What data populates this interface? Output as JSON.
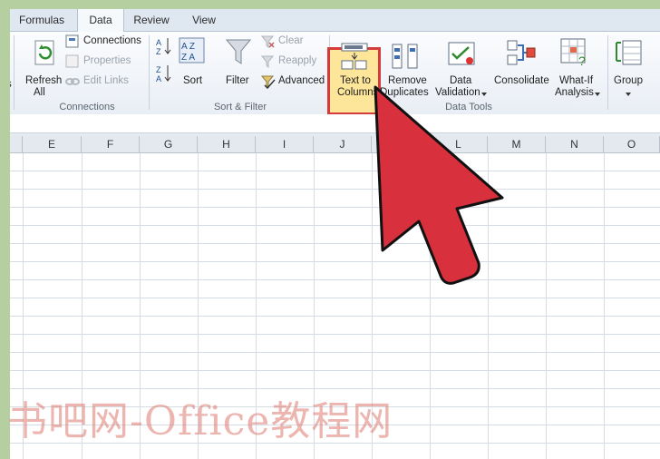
{
  "tabs": [
    {
      "label": "Formulas",
      "active": false
    },
    {
      "label": "Data",
      "active": true
    },
    {
      "label": "Review",
      "active": false
    },
    {
      "label": "View",
      "active": false
    }
  ],
  "ribbon": {
    "partial_left": "s",
    "connections": {
      "refresh": [
        "Refresh",
        "All"
      ],
      "connections": "Connections",
      "properties": "Properties",
      "edit_links": "Edit Links",
      "group_label": "Connections"
    },
    "sort_filter": {
      "sort": "Sort",
      "filter": "Filter",
      "clear": "Clear",
      "reapply": "Reapply",
      "advanced": "Advanced",
      "group_label": "Sort & Filter"
    },
    "data_tools": {
      "text_to_columns": [
        "Text to",
        "Columns"
      ],
      "remove_duplicates": [
        "Remove",
        "Duplicates"
      ],
      "data_validation": [
        "Data",
        "Validation"
      ],
      "consolidate": "Consolidate",
      "what_if": [
        "What-If",
        "Analysis"
      ],
      "group_label": "Data Tools"
    },
    "outline": {
      "group": "Group"
    }
  },
  "columns": [
    "E",
    "F",
    "G",
    "H",
    "I",
    "J",
    "K",
    "L",
    "M",
    "N",
    "O"
  ],
  "watermark": "书吧网-Office教程网",
  "colors": {
    "highlight_fill": "#fde59a",
    "highlight_border": "#d43b3b",
    "arrow": "#d9303d",
    "frame_bg": "#b5cfa0"
  }
}
